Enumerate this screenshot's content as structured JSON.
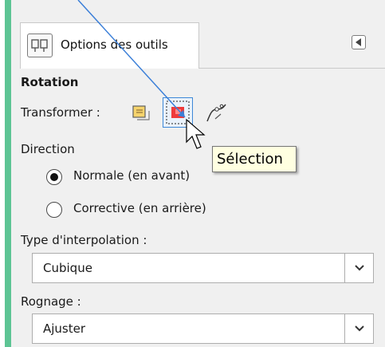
{
  "panel": {
    "tab_label": "Options des outils",
    "section_title": "Rotation"
  },
  "transform": {
    "label": "Transformer :",
    "options": [
      {
        "name": "layer",
        "icon": "layer-icon"
      },
      {
        "name": "selection",
        "icon": "selection-icon",
        "selected": true
      },
      {
        "name": "path",
        "icon": "path-icon"
      }
    ],
    "tooltip": "Sélection"
  },
  "direction": {
    "label": "Direction",
    "options": [
      {
        "label": "Normale (en avant)",
        "checked": true
      },
      {
        "label": "Corrective (en arrière)",
        "checked": false
      }
    ]
  },
  "interpolation": {
    "label": "Type d'interpolation :",
    "value": "Cubique"
  },
  "clipping": {
    "label": "Rognage :",
    "value": "Ajuster"
  },
  "colors": {
    "accent_green": "#5dc494",
    "annotation_arrow": "#3b7fd8",
    "tooltip_bg": "#ffffe1"
  }
}
